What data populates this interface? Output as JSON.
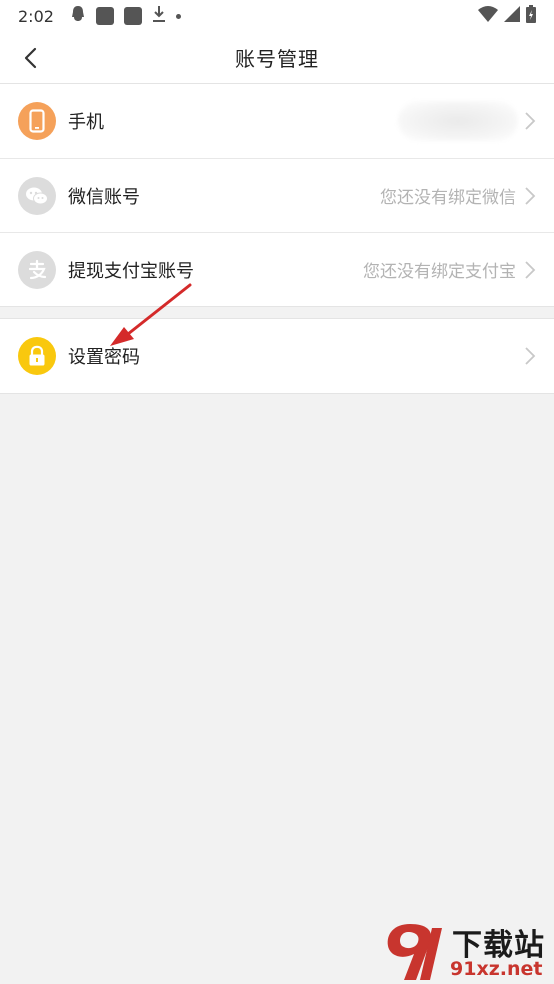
{
  "status_bar": {
    "time": "2:02"
  },
  "header": {
    "title": "账号管理"
  },
  "account_rows": [
    {
      "label": "手机",
      "value": "",
      "icon": "phone-icon",
      "icon_color": "#f5a15a"
    },
    {
      "label": "微信账号",
      "value": "您还没有绑定微信",
      "icon": "wechat-icon",
      "icon_color": "#dcdcdc"
    },
    {
      "label": "提现支付宝账号",
      "value": "您还没有绑定支付宝",
      "icon": "alipay-icon",
      "icon_color": "#dcdcdc"
    }
  ],
  "security_rows": [
    {
      "label": "设置密码",
      "icon": "lock-icon",
      "icon_color": "#f9c80e"
    }
  ],
  "watermark": {
    "logo_text": "下载站",
    "site": "91xz.net"
  },
  "colors": {
    "background": "#f2f2f2",
    "annotation_arrow": "#d42a2a",
    "hint_text": "#b3b3b3"
  }
}
